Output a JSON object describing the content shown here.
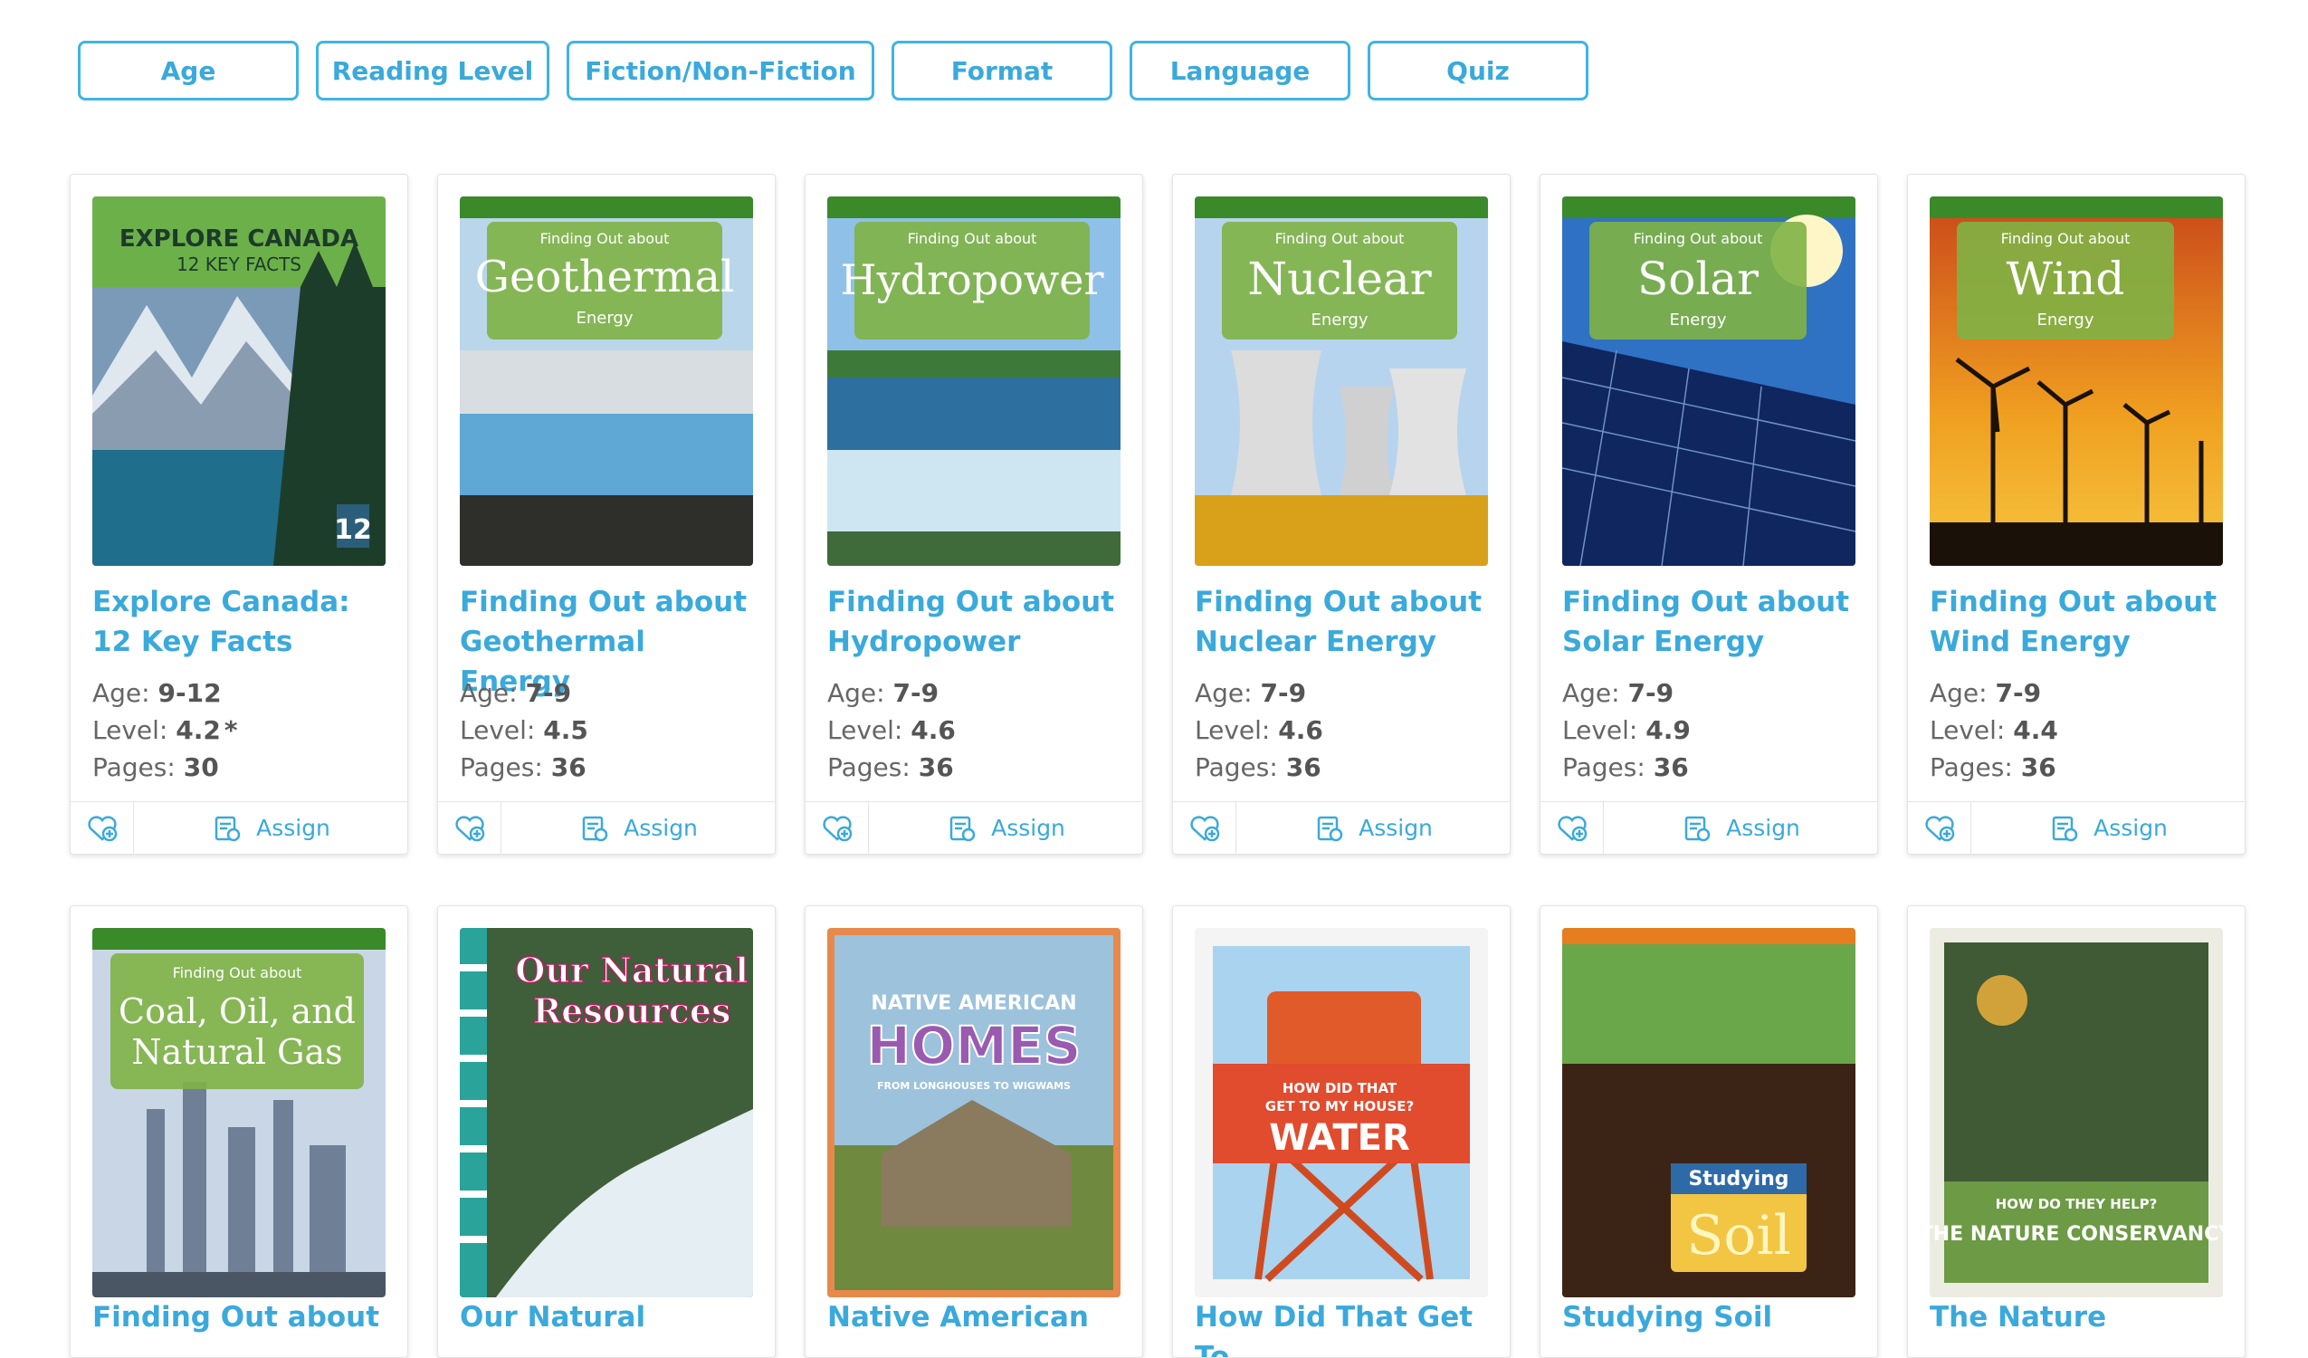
{
  "filters": [
    {
      "label": "Age"
    },
    {
      "label": "Reading Level"
    },
    {
      "label": "Fiction/Non-Fiction"
    },
    {
      "label": "Format"
    },
    {
      "label": "Language"
    },
    {
      "label": "Quiz"
    }
  ],
  "labels": {
    "age": "Age:",
    "level": "Level:",
    "pages": "Pages:",
    "assign": "Assign"
  },
  "books_row1": [
    {
      "title": "Explore Canada: 12 Key Facts",
      "age": "9-12",
      "level": "4.2",
      "level_mark": "*",
      "pages": "30"
    },
    {
      "title": "Finding Out about Geothermal Energy",
      "age": "7-9",
      "level": "4.5",
      "level_mark": "",
      "pages": "36"
    },
    {
      "title": "Finding Out about Hydropower",
      "age": "7-9",
      "level": "4.6",
      "level_mark": "",
      "pages": "36"
    },
    {
      "title": "Finding Out about Nuclear Energy",
      "age": "7-9",
      "level": "4.6",
      "level_mark": "",
      "pages": "36"
    },
    {
      "title": "Finding Out about Solar Energy",
      "age": "7-9",
      "level": "4.9",
      "level_mark": "",
      "pages": "36"
    },
    {
      "title": "Finding Out about Wind Energy",
      "age": "7-9",
      "level": "4.4",
      "level_mark": "",
      "pages": "36"
    }
  ],
  "books_row2": [
    {
      "title": "Finding Out about"
    },
    {
      "title": "Our Natural"
    },
    {
      "title": "Native American"
    },
    {
      "title": "How Did That Get To"
    },
    {
      "title": "Studying Soil"
    },
    {
      "title": "The Nature"
    }
  ],
  "covers": {
    "canada": {
      "line1": "EXPLORE CANADA",
      "line2": "12 KEY FACTS",
      "badge": "12"
    },
    "series_tag": "Finding Out about",
    "series_sub": "Energy",
    "geothermal": "Geothermal",
    "hydropower": "Hydropower",
    "nuclear": "Nuclear",
    "solar": "Solar",
    "wind": "Wind",
    "coal": "Coal, Oil, and",
    "coal2": "Natural Gas",
    "natural1": "Our Natural",
    "natural2": "Resources",
    "native_top": "NATIVE AMERICAN",
    "native_big": "HOMES",
    "native_sub": "FROM LONGHOUSES TO WIGWAMS",
    "water_top": "HOW DID THAT",
    "water_mid": "GET TO MY HOUSE?",
    "water_big": "WATER",
    "soil_top": "Studying",
    "soil_big": "Soil",
    "nc_top": "HOW DO THEY HELP?",
    "nc_big": "THE NATURE CONSERVANCY"
  },
  "colors": {
    "accent": "#3aa9db",
    "border": "#3fb4e3"
  }
}
